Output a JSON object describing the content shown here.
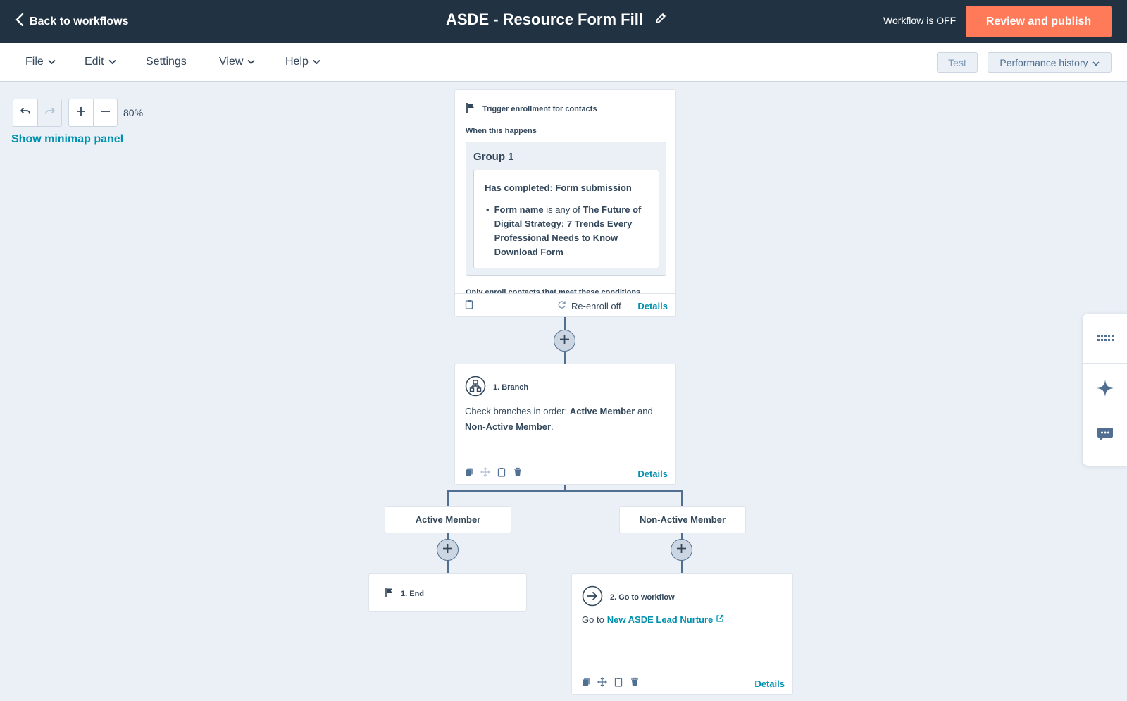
{
  "header": {
    "back_label": "Back to workflows",
    "title": "ASDE - Resource Form Fill",
    "status": "Workflow is OFF",
    "publish_label": "Review and publish"
  },
  "menubar": {
    "items": [
      "File",
      "Edit",
      "Settings",
      "View",
      "Help"
    ],
    "test_label": "Test",
    "performance_label": "Performance history"
  },
  "canvas": {
    "zoom": "80%",
    "minimap_label": "Show minimap panel"
  },
  "trigger": {
    "title": "Trigger enrollment for contacts",
    "when_label": "When this happens",
    "group_title": "Group 1",
    "condition_title": "Has completed: Form submission",
    "condition_field": "Form name",
    "condition_operator": "is any of",
    "condition_value": "The Future of Digital Strategy: 7 Trends Every Professional Needs to Know Download Form",
    "only_enroll": "Only enroll contacts that meet these conditions",
    "reenroll_label": "Re-enroll off",
    "details_label": "Details"
  },
  "branch": {
    "title": "1. Branch",
    "desc_prefix": "Check branches in order:",
    "branch_a": "Active Member",
    "desc_and": "and",
    "branch_b": "Non-Active Member",
    "desc_suffix": ".",
    "details_label": "Details"
  },
  "branches": {
    "left_label": "Active Member",
    "right_label": "Non-Active Member"
  },
  "end_action": {
    "title": "1. End"
  },
  "goto_action": {
    "title": "2. Go to workflow",
    "prefix": "Go to",
    "link": "New ASDE Lead Nurture",
    "details_label": "Details"
  },
  "side_panel": {
    "icons": [
      "grid-icon",
      "sparkle-icon",
      "chat-icon"
    ]
  },
  "colors": {
    "header_bg": "#213343",
    "accent": "#ff7a59",
    "link": "#0091ae",
    "canvas_bg": "#eaf0f6"
  }
}
